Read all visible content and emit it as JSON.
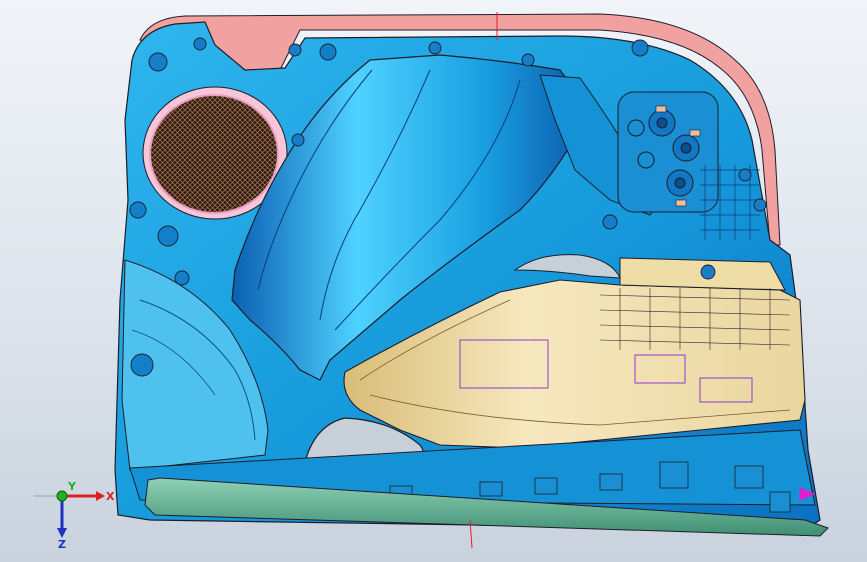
{
  "viewport": {
    "model": "car-door-trim-panel",
    "colors": {
      "background": "#e3e9f0",
      "panel_blue": "#1aa3e0",
      "panel_blue_dark": "#0a63b5",
      "armrest_tan": "#eedcaa",
      "top_edge_pink": "#f1a2a0",
      "speaker_mesh": "#3a2418",
      "bottom_strip_teal": "#5fae93",
      "outline": "#1d1d2a",
      "construction_line_red": "#e0202a"
    }
  },
  "axis_triad": {
    "x_label": "X",
    "y_label": "Y",
    "z_label": "Z",
    "x_color": "#e02020",
    "y_color": "#20b020",
    "z_color": "#2030c0"
  }
}
